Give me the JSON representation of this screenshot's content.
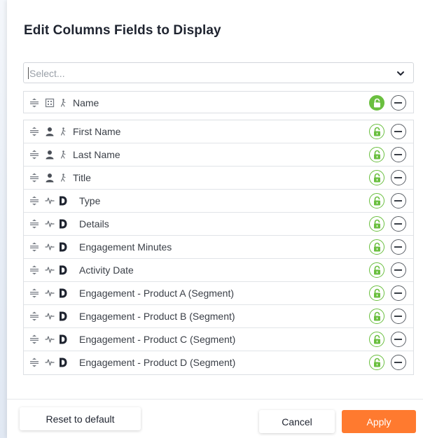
{
  "dialog": {
    "title": "Edit Columns Fields to Display"
  },
  "select": {
    "placeholder": "Select...",
    "icon": "chevron-down-icon"
  },
  "pinned_row": {
    "label": "Name",
    "type_icon": "building-icon",
    "sub_icon": "person-walk-icon",
    "locked": true
  },
  "rows": [
    {
      "label": "First Name",
      "type_icon": "person-icon",
      "sub_icon": "person-walk-icon",
      "locked": false
    },
    {
      "label": "Last Name",
      "type_icon": "person-icon",
      "sub_icon": "person-walk-icon",
      "locked": false
    },
    {
      "label": "Title",
      "type_icon": "person-icon",
      "sub_icon": "person-walk-icon",
      "locked": false
    },
    {
      "label": "Type",
      "type_icon": "activity-icon",
      "sub_icon": "d-logo-icon",
      "locked": false
    },
    {
      "label": "Details",
      "type_icon": "activity-icon",
      "sub_icon": "d-logo-icon",
      "locked": false
    },
    {
      "label": "Engagement Minutes",
      "type_icon": "activity-icon",
      "sub_icon": "d-logo-icon",
      "locked": false
    },
    {
      "label": "Activity Date",
      "type_icon": "activity-icon",
      "sub_icon": "d-logo-icon",
      "locked": false
    },
    {
      "label": "Engagement - Product A (Segment)",
      "type_icon": "activity-icon",
      "sub_icon": "d-logo-icon",
      "locked": false
    },
    {
      "label": "Engagement - Product B (Segment)",
      "type_icon": "activity-icon",
      "sub_icon": "d-logo-icon",
      "locked": false
    },
    {
      "label": "Engagement - Product C (Segment)",
      "type_icon": "activity-icon",
      "sub_icon": "d-logo-icon",
      "locked": false
    },
    {
      "label": "Engagement - Product D (Segment)",
      "type_icon": "activity-icon",
      "sub_icon": "d-logo-icon",
      "locked": false
    }
  ],
  "footer": {
    "reset_label": "Reset to default",
    "cancel_label": "Cancel",
    "apply_label": "Apply"
  },
  "colors": {
    "accent": "#ff7a2f",
    "lock_green": "#6abf3f"
  }
}
